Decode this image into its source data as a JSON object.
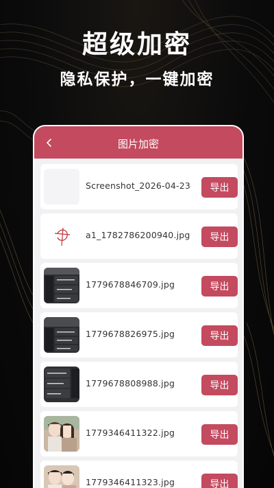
{
  "promo": {
    "title": "超级加密",
    "subtitle": "隐私保护，一键加密"
  },
  "app": {
    "header_title": "图片加密",
    "accent_color": "#c44a5f",
    "back_icon": "chevron-left-icon"
  },
  "files": [
    {
      "name": "Screenshot_2026-04-23-",
      "thumb": "blank-screenshot",
      "action": "导出"
    },
    {
      "name": "a1_1782786200940.jpg",
      "thumb": "red-sketch",
      "action": "导出"
    },
    {
      "name": "1779678846709.jpg",
      "thumb": "keyboard-keys",
      "action": "导出"
    },
    {
      "name": "1779678826975.jpg",
      "thumb": "keyboard-keys",
      "action": "导出"
    },
    {
      "name": "1779678808988.jpg",
      "thumb": "keyboard-keys",
      "action": "导出"
    },
    {
      "name": "1779346411322.jpg",
      "thumb": "anime-couple",
      "action": "导出"
    },
    {
      "name": "1779346411323.jpg",
      "thumb": "anime-couple",
      "action": "导出"
    }
  ]
}
